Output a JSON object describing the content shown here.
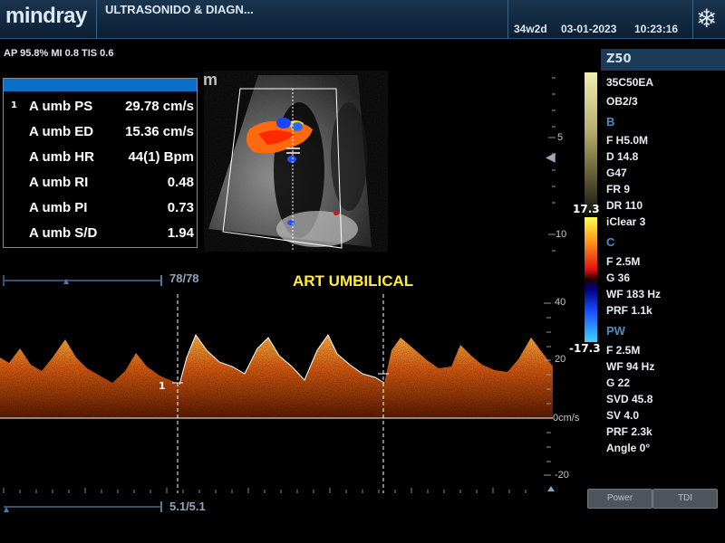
{
  "header": {
    "logo": "mindray",
    "hospital": "ULTRASONIDO & DIAGN...",
    "gestational_age": "34w2d",
    "date": "03-01-2023",
    "time": "10:23:16",
    "freeze_icon": "snowflake-icon"
  },
  "acoustic": "AP 95.8%  MI 0.8 TIS 0.6",
  "measurements": {
    "index": "1",
    "rows": [
      {
        "label": "A umb PS",
        "value": "29.78 cm/s"
      },
      {
        "label": "A umb ED",
        "value": "15.36 cm/s"
      },
      {
        "label": "A umb HR",
        "value": "44(1) Bpm"
      },
      {
        "label": "A umb RI",
        "value": "0.48"
      },
      {
        "label": "A umb PI",
        "value": "0.73"
      },
      {
        "label": "A umb S/D",
        "value": "1.94"
      }
    ]
  },
  "probe_marker": "m",
  "annotation": "ART UMBILICAL",
  "image_scale": {
    "mark_5": "5",
    "mark_10": "10"
  },
  "doppler_scale": {
    "v40": "40",
    "v20": "20",
    "v0": "0cm/s",
    "vneg20": "-20"
  },
  "baseline_label": "1",
  "frame_count_top": "78/78",
  "frame_count_bottom": "5.1/5.1",
  "right_panel": {
    "probe_tab": "Z50",
    "probe_model": "35C50EA",
    "preset": "OB2/3",
    "b_head": "B",
    "b_params": [
      "F H5.0M",
      "D 14.8",
      "G47",
      "FR 9",
      "DR 110",
      "iClear 3"
    ],
    "color_scale_top": "17.3",
    "color_scale_bottom": "-17.3",
    "c_head": "C",
    "c_params": [
      "F 2.5M",
      "G 36",
      "WF 183 Hz",
      "PRF 1.1k"
    ],
    "pw_head": "PW",
    "pw_params": [
      "F 2.5M",
      "WF 94 Hz",
      "G 22",
      "SVD 45.8",
      "SV 4.0",
      "PRF 2.3k",
      "Angle 0°"
    ]
  },
  "buttons": {
    "power": "Power",
    "tdi": "TDI"
  }
}
